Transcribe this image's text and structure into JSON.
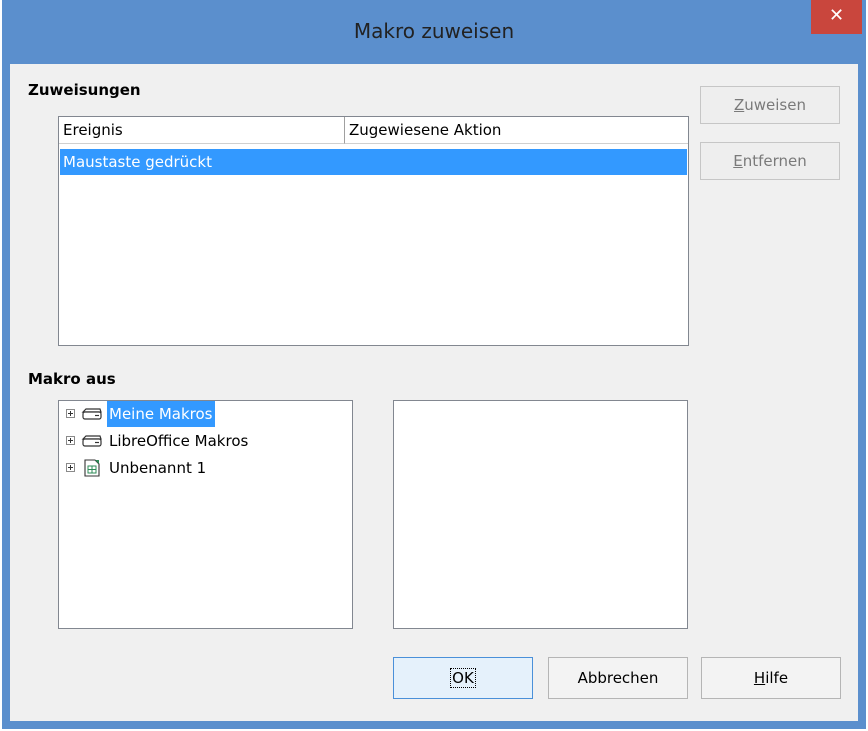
{
  "window": {
    "title": "Makro zuweisen",
    "close_glyph": "✕"
  },
  "assignments": {
    "label": "Zuweisungen",
    "columns": [
      "Ereignis",
      "Zugewiesene Aktion"
    ],
    "rows": [
      {
        "event": "Maustaste gedrückt",
        "action": ""
      }
    ]
  },
  "side_buttons": {
    "assign_prefix": "Z",
    "assign_rest": "uweisen",
    "remove_prefix": "E",
    "remove_rest": "ntfernen"
  },
  "macro_from": {
    "label": "Makro aus",
    "tree": [
      {
        "label": "Meine Makros",
        "icon": "drive-icon",
        "selected": true
      },
      {
        "label": "LibreOffice Makros",
        "icon": "drive-icon",
        "selected": false
      },
      {
        "label": "Unbenannt 1",
        "icon": "spreadsheet-icon",
        "selected": false
      }
    ]
  },
  "footer": {
    "ok": "OK",
    "cancel": "Abbrechen",
    "help_prefix": "H",
    "help_rest": "ilfe"
  },
  "colors": {
    "titlebar": "#5b8fcd",
    "selection": "#3399ff",
    "close": "#c9463d"
  }
}
